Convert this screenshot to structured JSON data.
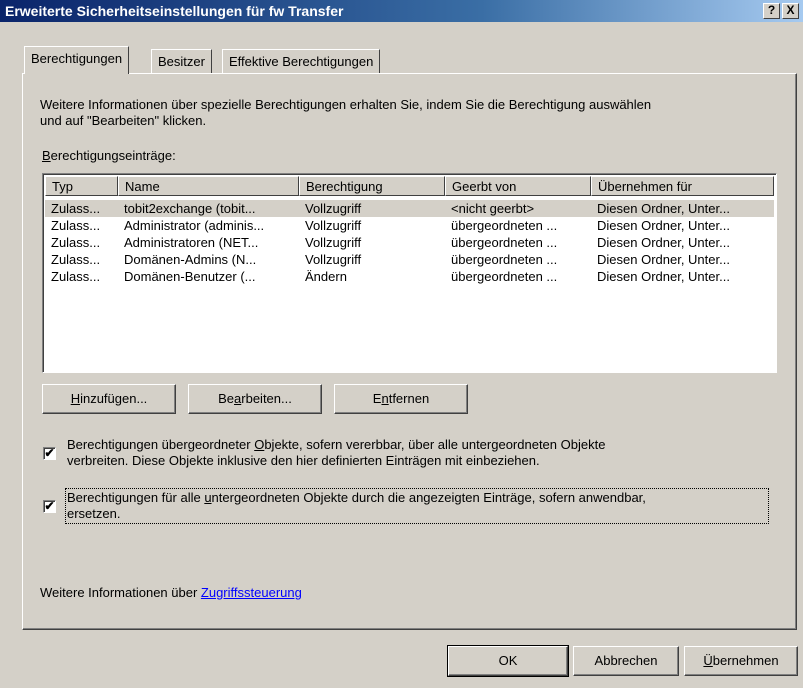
{
  "window": {
    "title": "Erweiterte Sicherheitseinstellungen für fw Transfer",
    "help_button": "?",
    "close_button": "X"
  },
  "tabs": [
    {
      "label": "Berechtigungen",
      "active": true
    },
    {
      "label": "Besitzer",
      "active": false
    },
    {
      "label": "Effektive Berechtigungen",
      "active": false
    }
  ],
  "info_text": {
    "line1": "Weitere Informationen über spezielle Berechtigungen erhalten Sie, indem Sie die Berechtigung auswählen",
    "line2": "und auf \"Bearbeiten\" klicken."
  },
  "entries_label": {
    "accel": "B",
    "rest": "erechtigungseinträge:"
  },
  "list": {
    "columns": [
      "Typ",
      "Name",
      "Berechtigung",
      "Geerbt von",
      "Übernehmen für"
    ],
    "rows": [
      {
        "typ": "Zulass...",
        "name": "tobit2exchange (tobit...",
        "perm": "Vollzugriff",
        "from": "<nicht geerbt>",
        "apply": "Diesen Ordner, Unter...",
        "selected": true
      },
      {
        "typ": "Zulass...",
        "name": "Administrator (adminis...",
        "perm": "Vollzugriff",
        "from": "übergeordneten ...",
        "apply": "Diesen Ordner, Unter...",
        "selected": false
      },
      {
        "typ": "Zulass...",
        "name": "Administratoren (NET...",
        "perm": "Vollzugriff",
        "from": "übergeordneten ...",
        "apply": "Diesen Ordner, Unter...",
        "selected": false
      },
      {
        "typ": "Zulass...",
        "name": "Domänen-Admins (N...",
        "perm": "Vollzugriff",
        "from": "übergeordneten ...",
        "apply": "Diesen Ordner, Unter...",
        "selected": false
      },
      {
        "typ": "Zulass...",
        "name": "Domänen-Benutzer (...",
        "perm": "Ändern",
        "from": "übergeordneten ...",
        "apply": "Diesen Ordner, Unter...",
        "selected": false
      }
    ]
  },
  "buttons": {
    "add": {
      "accel": "H",
      "rest": "inzufügen..."
    },
    "edit": {
      "pre": "Be",
      "accel": "a",
      "rest": "rbeiten..."
    },
    "remove": {
      "pre": "E",
      "accel": "n",
      "rest": "tfernen"
    }
  },
  "checkbox1": {
    "checked": true,
    "line1_pre": "Berechtigungen übergeordneter ",
    "line1_accel": "O",
    "line1_rest": "bjekte, sofern vererbbar, über alle untergeordneten Objekte",
    "line2": "verbreiten. Diese Objekte inklusive den hier definierten Einträgen mit einbeziehen."
  },
  "checkbox2": {
    "checked": true,
    "line1_pre": "Berechtigungen für alle ",
    "line1_accel": "u",
    "line1_rest": "ntergeordneten Objekte durch die angezeigten Einträge, sofern anwendbar,",
    "line2": "ersetzen."
  },
  "more_info": {
    "prefix": "Weitere Informationen über ",
    "link": "Zugriffssteuerung"
  },
  "footer": {
    "ok": "OK",
    "cancel": "Abbrechen",
    "apply_accel": "Ü",
    "apply_rest": "bernehmen"
  }
}
